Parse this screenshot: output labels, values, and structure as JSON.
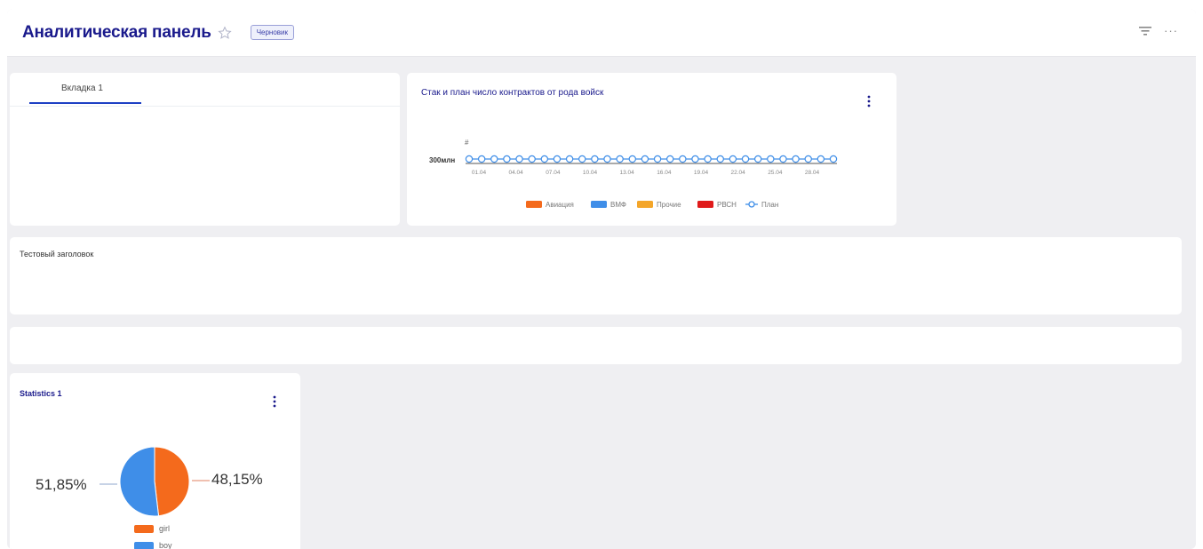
{
  "header": {
    "title": "Аналитическая панель",
    "badge": "Черновик",
    "icons": [
      "star-icon",
      "filter-icon",
      "more-horizontal-icon"
    ]
  },
  "tabs": [
    {
      "label": "Вкладка 1",
      "active": true
    }
  ],
  "chart_widget": {
    "title": "Стак и план число контрактов от рода войск",
    "menu_icon": "more-vertical-icon",
    "chart_data": {
      "type": "line",
      "x": [
        "01.04",
        "04.04",
        "07.04",
        "10.04",
        "13.04",
        "16.04",
        "19.04",
        "22.04",
        "25.04",
        "28.04"
      ],
      "ylabel": "#",
      "ytick": "300млн",
      "series": [
        {
          "name": "Авиация",
          "color": "#f46a1c"
        },
        {
          "name": "ВМФ",
          "color": "#3f8ee8"
        },
        {
          "name": "Прочие",
          "color": "#f4a62a"
        },
        {
          "name": "РВСН",
          "color": "#e01b1b"
        },
        {
          "name": "План",
          "color": "#3f8ee8",
          "marker": "circle"
        }
      ],
      "plan_points": 30
    }
  },
  "text_widget": {
    "title": "Тестовый заголовок"
  },
  "stats_widget": {
    "title": "Statistics 1",
    "menu_icon": "more-vertical-icon",
    "chart_data": {
      "type": "pie",
      "slices": [
        {
          "label": "girl",
          "value": 48.15,
          "display": "48,15%",
          "color": "#f46a1c"
        },
        {
          "label": "boy",
          "value": 51.85,
          "display": "51,85%",
          "color": "#3f8ee8"
        }
      ]
    }
  }
}
